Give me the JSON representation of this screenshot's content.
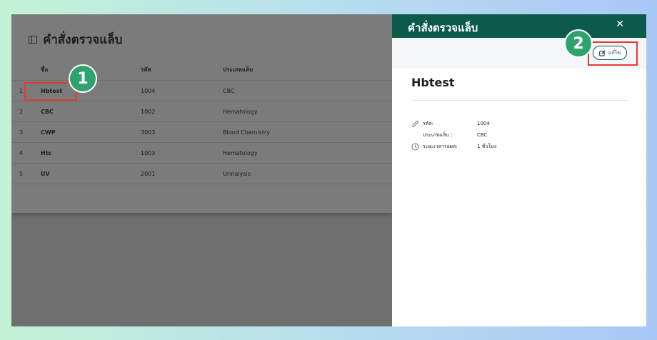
{
  "page": {
    "title": "คำสั่งตรวจแล็บ",
    "icon": "layout-sidebar-icon",
    "table": {
      "headers": [
        "ชื่อ",
        "รหัส",
        "ประเภทแล็บ"
      ],
      "rows": [
        {
          "index": "1",
          "name": "Hbtest",
          "code": "1004",
          "type": "CBC"
        },
        {
          "index": "2",
          "name": "CBC",
          "code": "1002",
          "type": "Hematology"
        },
        {
          "index": "3",
          "name": "CWP",
          "code": "3003",
          "type": "Blood Chemistry"
        },
        {
          "index": "4",
          "name": "Htc",
          "code": "1003",
          "type": "Hematology"
        },
        {
          "index": "5",
          "name": "UV",
          "code": "2001",
          "type": "Urinalysis"
        }
      ]
    }
  },
  "annotations": {
    "step1": "1",
    "step2": "2",
    "highlight_color": "#e53935",
    "badge_color": "#2fa36e"
  },
  "drawer": {
    "title": "คำสั่งตรวจแล็บ",
    "close_icon": "close-icon",
    "edit_label": "แก้ไข",
    "edit_icon": "edit-icon",
    "record_title": "Hbtest",
    "details": {
      "code_label": "รหัส:",
      "code_value": "1004",
      "type_label": "ประเภทแล็บ :",
      "type_value": "CBC",
      "time_label": "ระยะเวลารอผล:",
      "time_value": "1 ชั่วโมง"
    },
    "header_color": "#0b5a4a"
  }
}
